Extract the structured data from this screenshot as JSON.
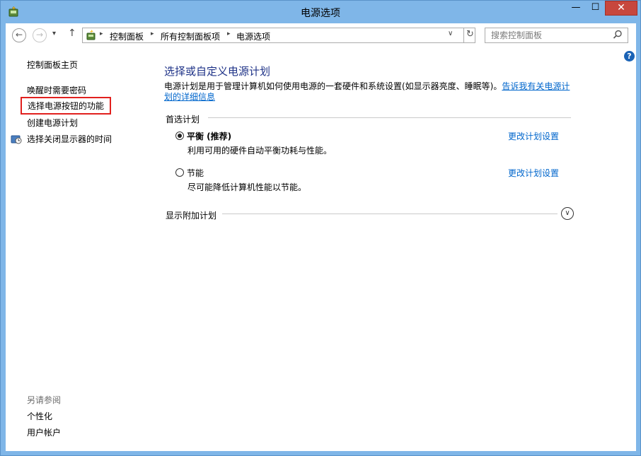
{
  "window": {
    "title": "电源选项",
    "controls": {
      "minimize": "—",
      "maximize": "☐",
      "close": "✕"
    }
  },
  "nav": {
    "back": "←",
    "forward": "→",
    "recent": "▾",
    "up": "↑",
    "address": {
      "crumbs": [
        "控制面板",
        "所有控制面板项",
        "电源选项"
      ],
      "separator": "▸",
      "dropdown": "∨",
      "refresh": "↻"
    },
    "search": {
      "placeholder": "搜索控制面板"
    }
  },
  "help": "?",
  "sidebar": {
    "home": "控制面板主页",
    "links": [
      "唤醒时需要密码",
      "选择电源按钮的功能",
      "创建电源计划",
      "选择关闭显示器的时间"
    ],
    "see_also": {
      "title": "另请参阅",
      "links": [
        "个性化",
        "用户帐户"
      ]
    }
  },
  "main": {
    "title": "选择或自定义电源计划",
    "description": "电源计划是用于管理计算机如何使用电源的一套硬件和系统设置(如显示器亮度、睡眠等)。",
    "description_link": "告诉我有关电源计划的详细信息",
    "preferred_header": "首选计划",
    "plans": [
      {
        "name": "平衡 (推荐)",
        "desc": "利用可用的硬件自动平衡功耗与性能。",
        "link": "更改计划设置",
        "selected": true
      },
      {
        "name": "节能",
        "desc": "尽可能降低计算机性能以节能。",
        "link": "更改计划设置",
        "selected": false
      }
    ],
    "show_more": "显示附加计划",
    "expand": "∨"
  },
  "colors": {
    "frame": "#7fb6e8",
    "link": "#0066cc",
    "title": "#1e3287",
    "highlight_box": "#e1201e",
    "close_button": "#c7473d"
  }
}
